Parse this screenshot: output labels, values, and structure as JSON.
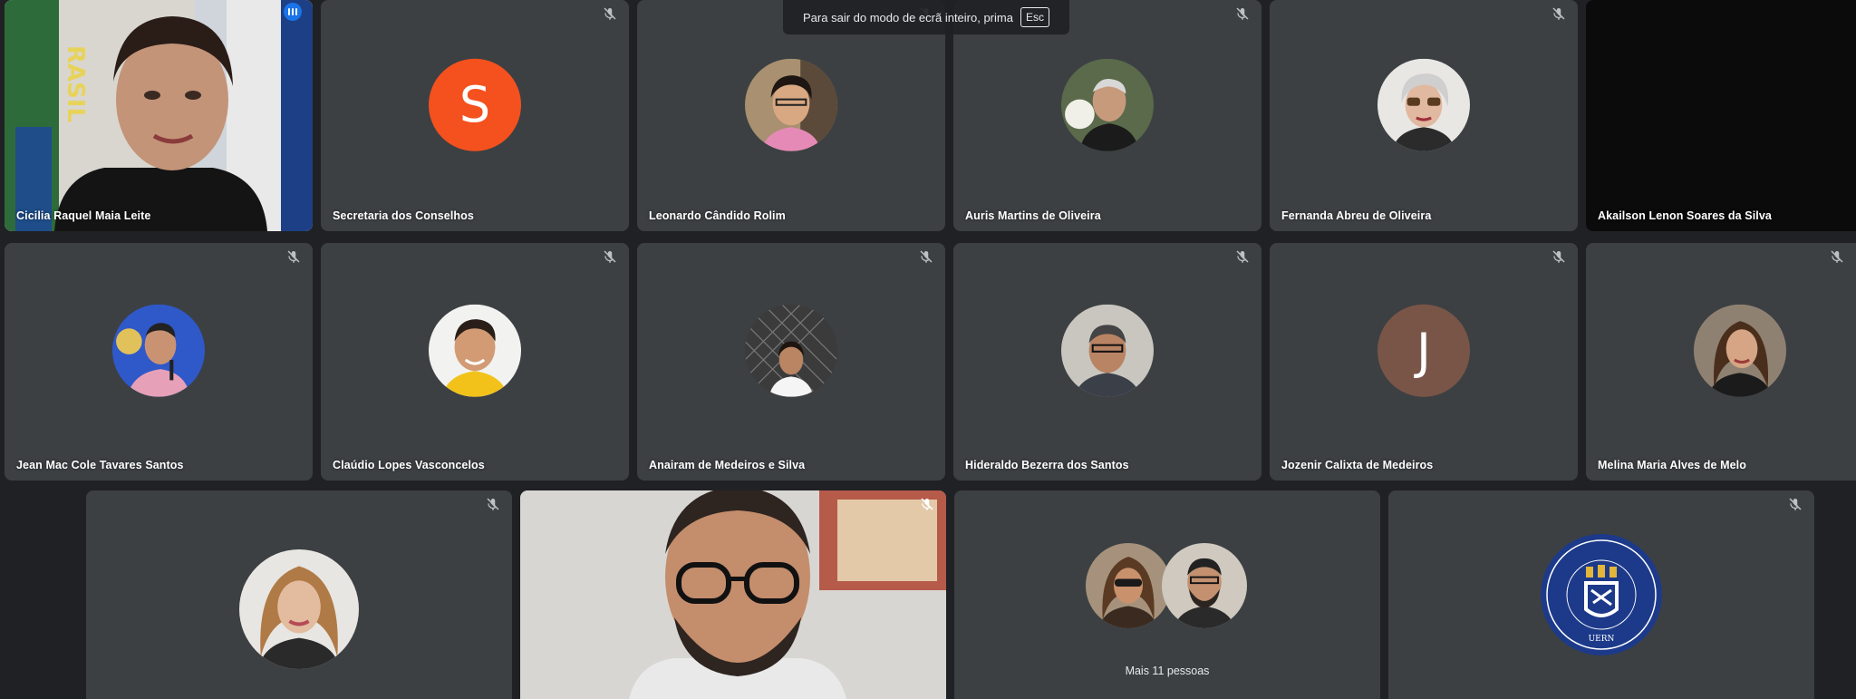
{
  "fullscreen_toast": {
    "message": "Para sair do modo de ecrã inteiro, prima",
    "key": "Esc"
  },
  "participants_row1": [
    {
      "name": "Cicilia Raquel Maia Leite",
      "kind": "video"
    },
    {
      "name": "Secretaria dos Conselhos",
      "kind": "letter",
      "letter": "S",
      "color": "#f4511e"
    },
    {
      "name": "Leonardo Cândido Rolim",
      "kind": "photo"
    },
    {
      "name": "Auris Martins de Oliveira",
      "kind": "photo"
    },
    {
      "name": "Fernanda Abreu de Oliveira",
      "kind": "photo"
    },
    {
      "name": "Akailson Lenon Soares da Silva",
      "kind": "dark"
    }
  ],
  "participants_row2": [
    {
      "name": "Jean Mac Cole Tavares Santos",
      "kind": "photo"
    },
    {
      "name": "Claúdio Lopes Vasconcelos",
      "kind": "photo"
    },
    {
      "name": "Anairam de Medeiros e Silva",
      "kind": "photo"
    },
    {
      "name": "Hideraldo Bezerra dos Santos",
      "kind": "photo"
    },
    {
      "name": "Jozenir Calixta de Medeiros",
      "kind": "letter",
      "letter": "J",
      "color": "#795548"
    },
    {
      "name": "Melina Maria Alves de Melo",
      "kind": "photo"
    }
  ],
  "participants_row3": [
    {
      "kind": "photo"
    },
    {
      "kind": "video"
    },
    {
      "kind": "more",
      "label": "Mais 11 pessoas"
    },
    {
      "kind": "logo",
      "logo_text": "UNIVERSIDADE DO ESTADO DO RIO GRANDE DO NORTE",
      "logo_initials": "UERN"
    }
  ],
  "icons": {
    "muted": "mic-off-icon",
    "speaking": "audio-level-icon"
  },
  "colors": {
    "background": "#202124",
    "tile": "#3c4043",
    "active_border": "#8ab4f8"
  }
}
